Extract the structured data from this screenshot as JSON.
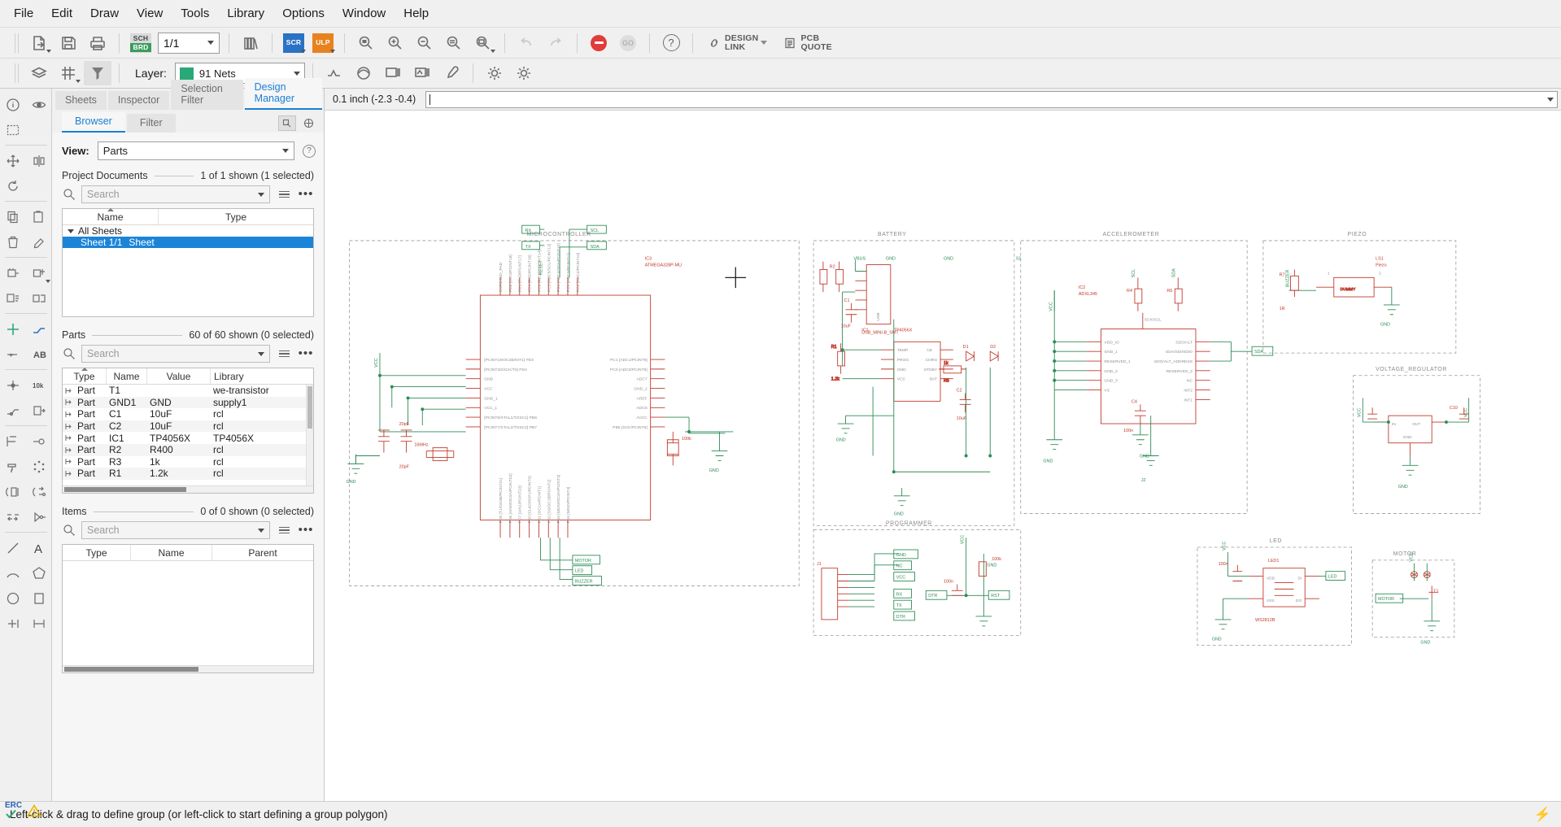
{
  "app": {
    "name": "EAGLE Schematic Editor"
  },
  "menubar": {
    "items": [
      {
        "label": "File"
      },
      {
        "label": "Edit"
      },
      {
        "label": "Draw"
      },
      {
        "label": "View"
      },
      {
        "label": "Tools"
      },
      {
        "label": "Library"
      },
      {
        "label": "Options"
      },
      {
        "label": "Window"
      },
      {
        "label": "Help"
      }
    ]
  },
  "toolbar_main": {
    "page_value": "1/1",
    "sch_badge_top": "SCH",
    "sch_badge_bottom": "BRD",
    "scr_badge": "SCR",
    "ulp_badge": "ULP",
    "go_label": "GO",
    "help_label": "?",
    "design_link_line1": "DESIGN",
    "design_link_line2": "LINK",
    "pcb_quote_line1": "PCB",
    "pcb_quote_line2": "QUOTE"
  },
  "toolbar_layer": {
    "layer_label": "Layer:",
    "layer_value": "91 Nets",
    "layer_color": "#2aa878"
  },
  "panel": {
    "tabs": [
      {
        "label": "Sheets",
        "selected": false
      },
      {
        "label": "Inspector",
        "selected": false
      },
      {
        "label": "Selection Filter",
        "selected": false
      },
      {
        "label": "Design Manager",
        "selected": true
      }
    ],
    "subtabs": [
      {
        "label": "Browser",
        "selected": true
      },
      {
        "label": "Filter",
        "selected": false
      }
    ],
    "view_label": "View:",
    "view_value": "Parts",
    "help_badge": "?",
    "project_documents": {
      "title": "Project Documents",
      "count": "1 of 1 shown (1 selected)",
      "search_placeholder": "Search",
      "columns": [
        "Name",
        "Type"
      ],
      "tree": [
        {
          "label": "All Sheets",
          "type": "",
          "depth": 0,
          "expanded": true,
          "selected": false
        },
        {
          "label": "Sheet 1/1",
          "type": "Sheet",
          "depth": 1,
          "expanded": false,
          "selected": true
        }
      ]
    },
    "parts": {
      "title": "Parts",
      "count": "60 of 60 shown (0 selected)",
      "search_placeholder": "Search",
      "columns": [
        "Type",
        "Name",
        "Value",
        "Library"
      ],
      "rows": [
        {
          "type": "Part",
          "name": "T1",
          "value": "",
          "library": "we-transistor"
        },
        {
          "type": "Part",
          "name": "GND1",
          "value": "GND",
          "library": "supply1"
        },
        {
          "type": "Part",
          "name": "C1",
          "value": "10uF",
          "library": "rcl"
        },
        {
          "type": "Part",
          "name": "C2",
          "value": "10uF",
          "library": "rcl"
        },
        {
          "type": "Part",
          "name": "IC1",
          "value": "TP4056X",
          "library": "TP4056X"
        },
        {
          "type": "Part",
          "name": "R2",
          "value": "R400",
          "library": "rcl"
        },
        {
          "type": "Part",
          "name": "R3",
          "value": "1k",
          "library": "rcl"
        },
        {
          "type": "Part",
          "name": "R1",
          "value": "1.2k",
          "library": "rcl"
        }
      ]
    },
    "items": {
      "title": "Items",
      "count": "0 of 0 shown (0 selected)",
      "search_placeholder": "Search",
      "columns": [
        "Type",
        "Name",
        "Parent"
      ],
      "rows": []
    }
  },
  "command_bar": {
    "coordinate": "0.1 inch (-2.3 -0.4)",
    "input_value": ""
  },
  "statusbar": {
    "message": "Left-click & drag to define group (or left-click to start defining a group polygon)"
  },
  "erc": {
    "label": "ERC"
  },
  "schematic": {
    "blocks": [
      {
        "id": "microcontroller",
        "title": "MICROCONTROLLER"
      },
      {
        "id": "battery",
        "title": "BATTERY"
      },
      {
        "id": "accelerometer",
        "title": "ACCELEROMETER"
      },
      {
        "id": "piezo",
        "title": "PIEZO"
      },
      {
        "id": "voltage_regulator",
        "title": "VOLTAGE_REGULATOR"
      },
      {
        "id": "programmer",
        "title": "PROGRAMMER"
      },
      {
        "id": "led",
        "title": "LED"
      },
      {
        "id": "motor",
        "title": "MOTOR"
      }
    ],
    "mcu": {
      "part": "IC3",
      "device": "ATMEGA328P-MU",
      "left_pins": [
        "[PCINT19/OC2B/INT1] PD3",
        "[PCINT20/XCK/T0] PD4",
        "GND",
        "VCC",
        "GND_1",
        "VCC_1",
        "[PCINT6/XTAL1/TOSC1] PB6",
        "[PCINT7/XTAL2/TOSC2] PB7"
      ],
      "right_pins": [
        "PC1 [ADC1/PCINT9]",
        "PC0 [ADC0/PCINT8]",
        "ADC7",
        "GND_2",
        "AREF",
        "ADC6",
        "AVCC",
        "PB5 [SCK/PCINT5]"
      ],
      "top_pins": "EXPOSED_PAD  PD2 [INT0/PCINT18]  PD1 [TXD/PCINT17]  PD0 [RXD/PCINT16]  PC6 [RESET/PCINT14]  PC5 [ADC5/SCL/PCINT13]  PC4 [ADC4/SDA/PCINT12]  PC3 [ADC3/PCINT11]  PC2 [ADC2/PCINT10]",
      "bottom_pins": "PD5 [T1/OC0B/PCINT21]  PD6 [AIN0/OC0A/PCINT22]  PD7 [AIN1/PCINT23]  PB0 [CLKO/ICP1/PCINT0]  PB1 [OC1A/PCINT1]  PB2 [SS/OC1B/PCINT2]  PB3 [MOSI/OC2A/PCINT3]  PB4 [MISO/PCINT4]"
    },
    "labels": {
      "rx": "RX",
      "tx": "TX",
      "reset": "RESET",
      "scl": "SCL",
      "sda": "SDA",
      "motor": "MOTOR",
      "led": "LED",
      "buzzer": "BUZZER",
      "gnd": "GND",
      "vcc": "VCC",
      "nc": "NC",
      "dtr": "DTR",
      "rst": "RST",
      "xtal": "16MHz",
      "c6": "20pF",
      "c7": "20pF",
      "r_100": "100k",
      "battery_usb": "USB",
      "usb_part": "USB_MINI-B_SMT",
      "bat_ic": "IC1",
      "bat_ic_val": "TP4056X",
      "accel_ic": "IC2",
      "accel_ic_val": "ADXL345",
      "piezo_part": "LS1",
      "piezo_val": "Piezo",
      "dummy": "DUMMY",
      "led_part": "LED1",
      "led_val": "WS2812B",
      "c_10uf": "10uF",
      "r_1k": "1k",
      "r_12k": "1.2k",
      "r_400": "R400",
      "vbus": "VBUS",
      "temp": "TEMP",
      "prog": "PROG",
      "ce": "CE",
      "chrg": "CHRG",
      "stdby": "STDBY",
      "bat": "BAT"
    }
  }
}
